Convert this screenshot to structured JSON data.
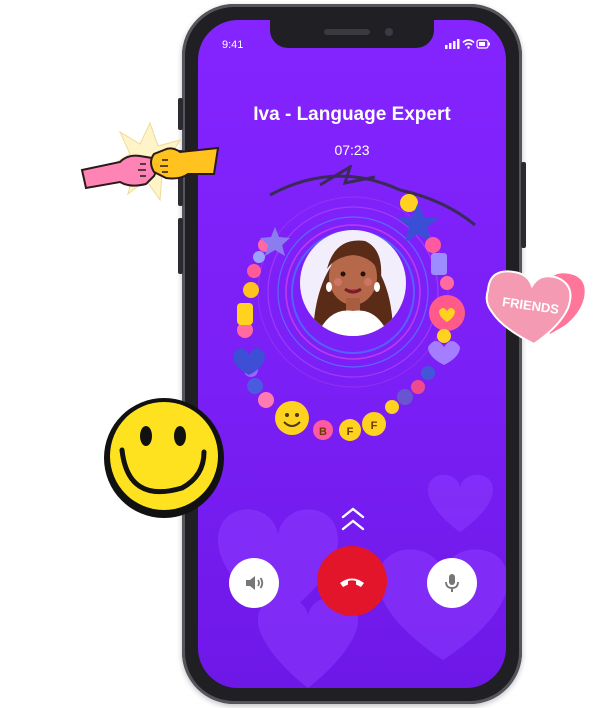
{
  "status_bar": {
    "time": "9:41"
  },
  "call": {
    "caller_name": "Iva - Language Expert",
    "duration": "07:23"
  },
  "bracelet": {
    "beads": [
      "B",
      "F",
      "F"
    ]
  },
  "stickers": {
    "friends_text": "FRIENDS"
  },
  "colors": {
    "screen": "#7b1ff7",
    "end_call": "#e3152b",
    "smiley": "#ffe21f",
    "heart_pink": "#f59ab3"
  },
  "icons": {
    "speaker_button": "speaker-icon",
    "end_call_button": "phone-hangup-icon",
    "mic_button": "microphone-icon",
    "swipe_hint": "double-chevron-up-icon"
  }
}
